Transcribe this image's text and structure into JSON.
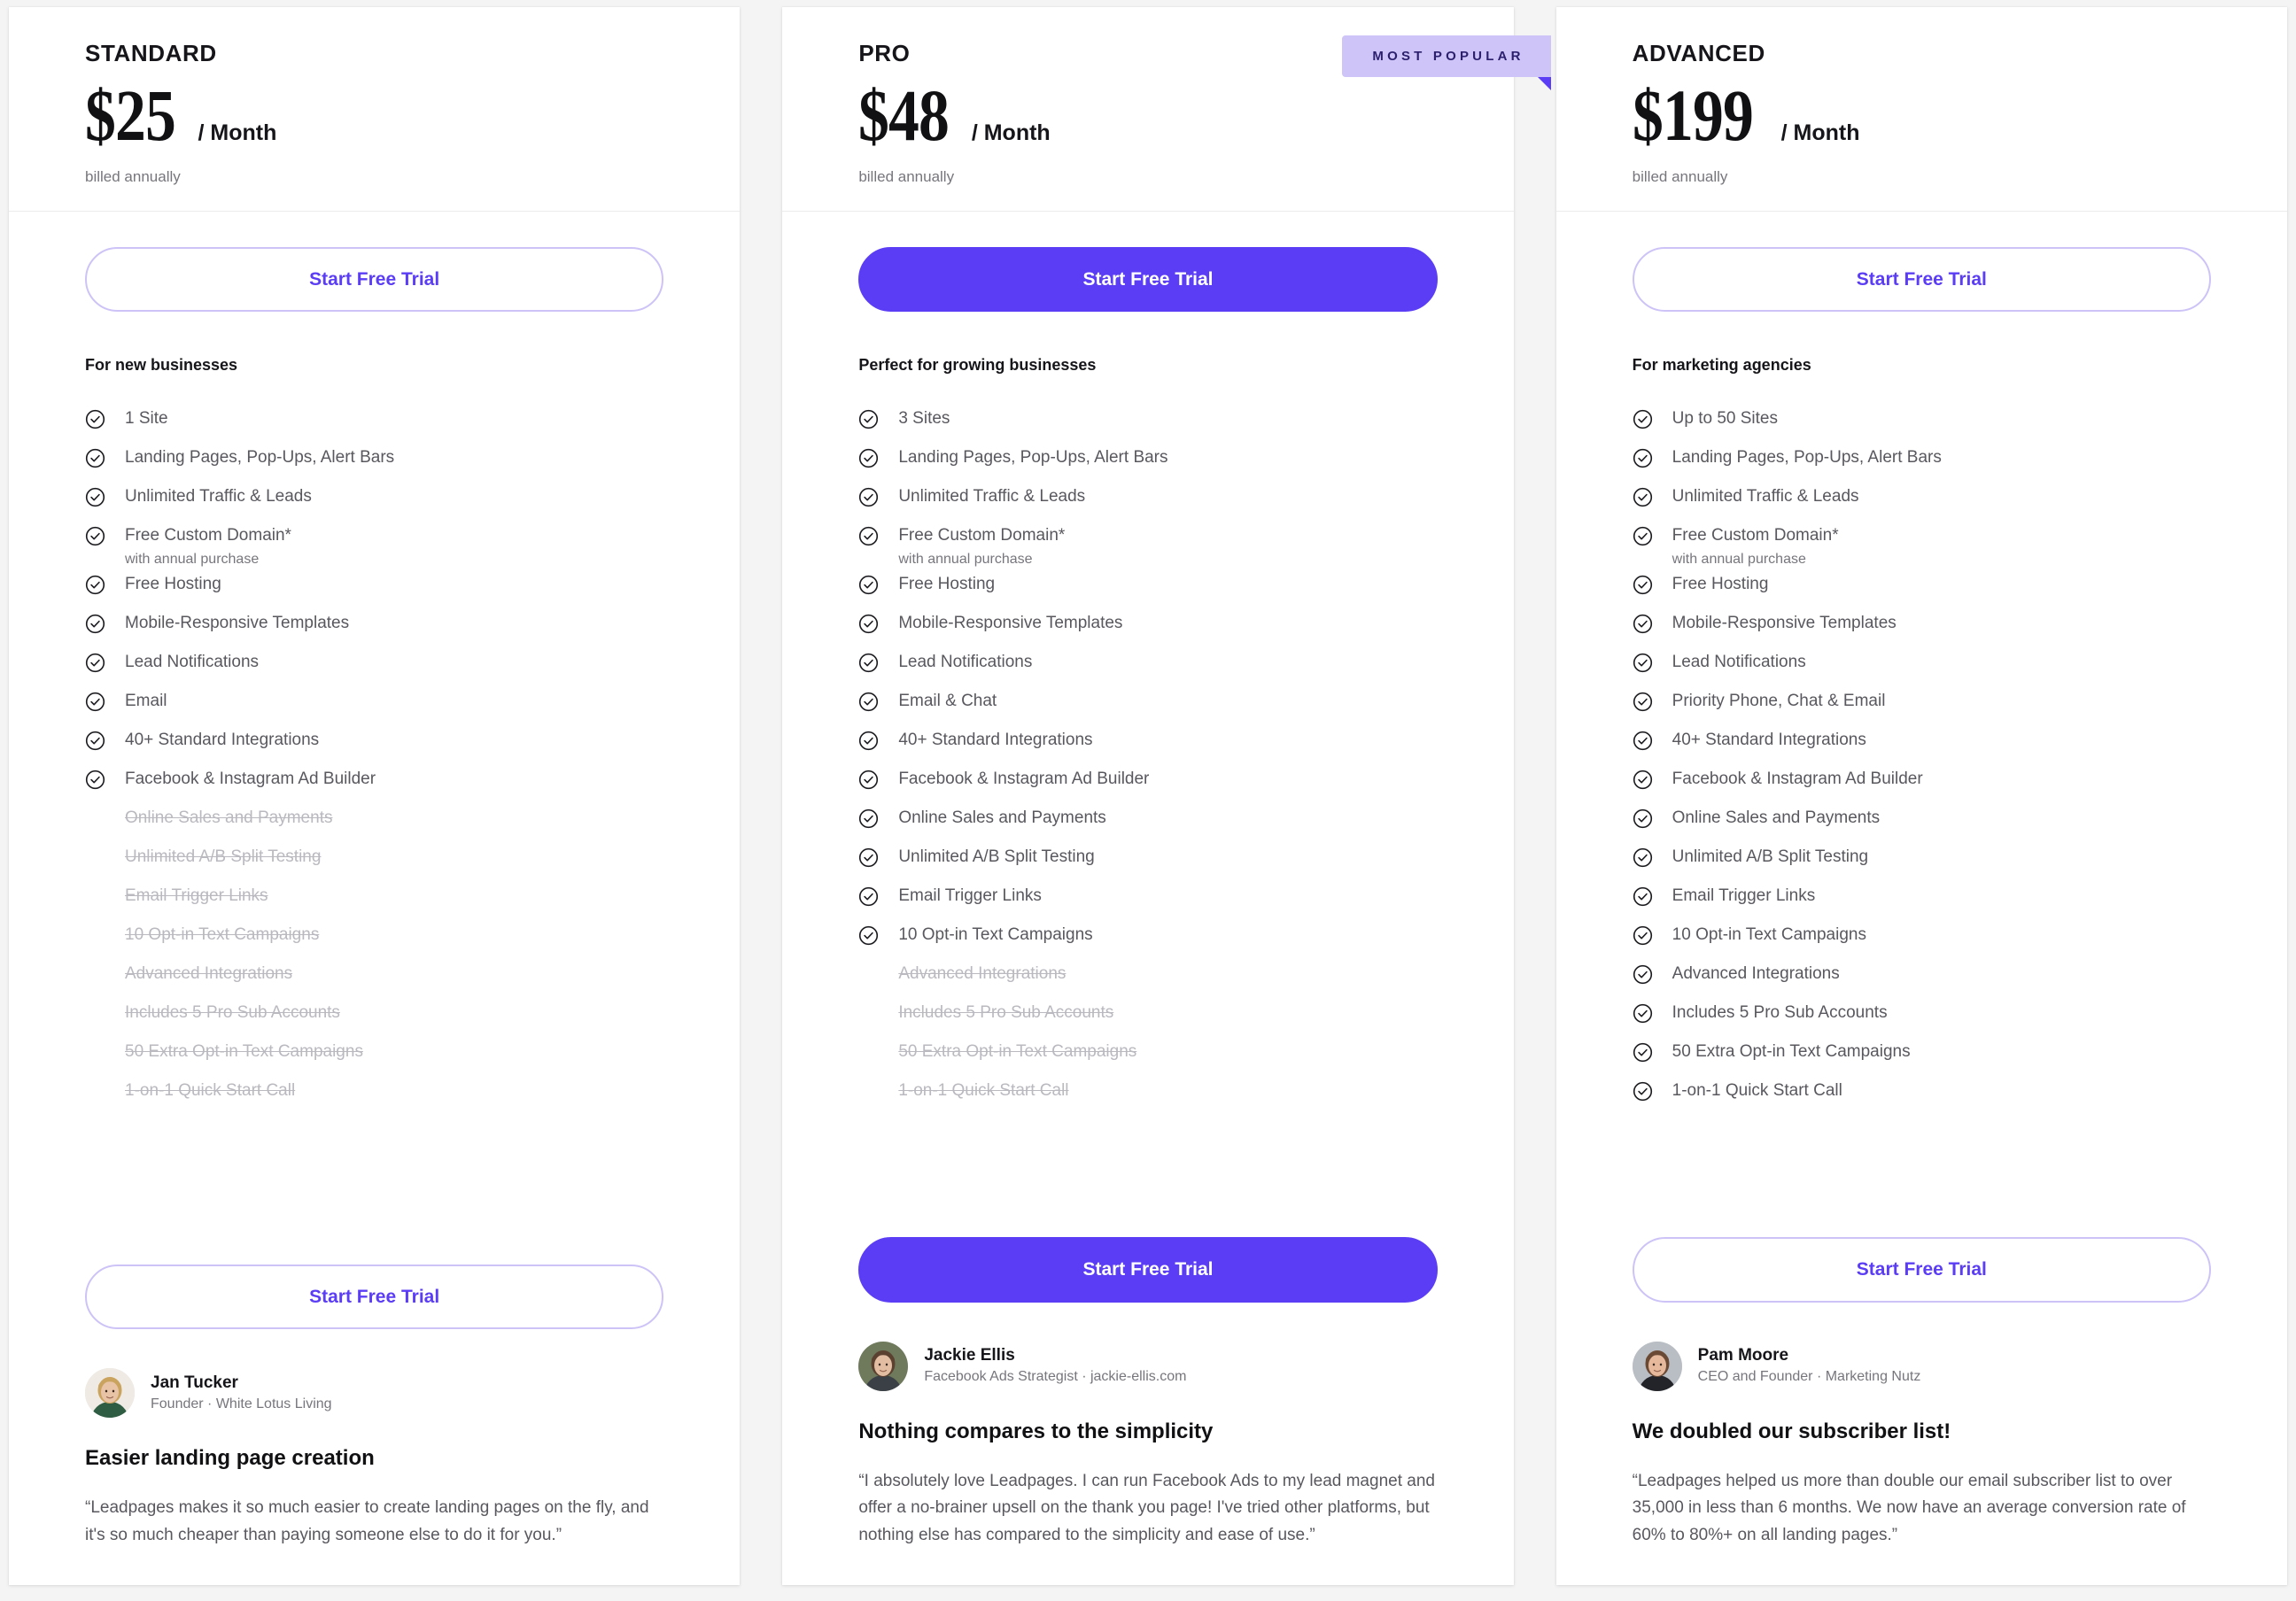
{
  "colors": {
    "accent": "#5b3df5",
    "accent_light": "#cdc3f7",
    "badge_bg": "#cec4f7",
    "badge_text": "#2b1f6e",
    "page_bg": "#f4f4f5",
    "card_bg": "#ffffff",
    "text_dark": "#16161a",
    "text_body": "#58585e",
    "text_muted": "#76767c",
    "text_disabled": "#b9b9bf"
  },
  "plans": [
    {
      "name": "STANDARD",
      "price": "$25",
      "period": "/ Month",
      "billing_note": "billed annually",
      "badge": null,
      "cta_top_label": "Start Free Trial",
      "cta_bottom_label": "Start Free Trial",
      "cta_style": "outline",
      "tagline": "For new businesses",
      "features": [
        {
          "label": "1 Site",
          "sub": null,
          "enabled": true
        },
        {
          "label": "Landing Pages, Pop-Ups, Alert Bars",
          "sub": null,
          "enabled": true
        },
        {
          "label": "Unlimited Traffic & Leads",
          "sub": null,
          "enabled": true
        },
        {
          "label": "Free Custom Domain*",
          "sub": "with annual purchase",
          "enabled": true
        },
        {
          "label": "Free Hosting",
          "sub": null,
          "enabled": true
        },
        {
          "label": "Mobile-Responsive Templates",
          "sub": null,
          "enabled": true
        },
        {
          "label": "Lead Notifications",
          "sub": null,
          "enabled": true
        },
        {
          "label": "Email",
          "sub": null,
          "enabled": true
        },
        {
          "label": "40+ Standard Integrations",
          "sub": null,
          "enabled": true
        },
        {
          "label": "Facebook & Instagram Ad Builder",
          "sub": null,
          "enabled": true
        },
        {
          "label": "Online Sales and Payments",
          "sub": null,
          "enabled": false
        },
        {
          "label": "Unlimited A/B Split Testing",
          "sub": null,
          "enabled": false
        },
        {
          "label": "Email Trigger Links",
          "sub": null,
          "enabled": false
        },
        {
          "label": "10 Opt-in Text Campaigns",
          "sub": null,
          "enabled": false
        },
        {
          "label": "Advanced Integrations",
          "sub": null,
          "enabled": false
        },
        {
          "label": "Includes 5 Pro Sub Accounts",
          "sub": null,
          "enabled": false
        },
        {
          "label": "50 Extra Opt-in Text Campaigns",
          "sub": null,
          "enabled": false
        },
        {
          "label": "1-on-1 Quick Start Call",
          "sub": null,
          "enabled": false
        }
      ],
      "testimonial": {
        "name": "Jan Tucker",
        "title": "Founder · White Lotus Living",
        "headline": "Easier landing page creation",
        "quote": "“Leadpages makes it so much easier to create landing pages on the fly, and it's so much cheaper than paying someone else to do it for you.”"
      }
    },
    {
      "name": "PRO",
      "price": "$48",
      "period": "/ Month",
      "billing_note": "billed annually",
      "badge": "MOST POPULAR",
      "cta_top_label": "Start Free Trial",
      "cta_bottom_label": "Start Free Trial",
      "cta_style": "filled",
      "tagline": "Perfect for growing businesses",
      "features": [
        {
          "label": "3 Sites",
          "sub": null,
          "enabled": true
        },
        {
          "label": "Landing Pages, Pop-Ups, Alert Bars",
          "sub": null,
          "enabled": true
        },
        {
          "label": "Unlimited Traffic & Leads",
          "sub": null,
          "enabled": true
        },
        {
          "label": "Free Custom Domain*",
          "sub": "with annual purchase",
          "enabled": true
        },
        {
          "label": "Free Hosting",
          "sub": null,
          "enabled": true
        },
        {
          "label": "Mobile-Responsive Templates",
          "sub": null,
          "enabled": true
        },
        {
          "label": "Lead Notifications",
          "sub": null,
          "enabled": true
        },
        {
          "label": "Email & Chat",
          "sub": null,
          "enabled": true
        },
        {
          "label": "40+ Standard Integrations",
          "sub": null,
          "enabled": true
        },
        {
          "label": "Facebook & Instagram Ad Builder",
          "sub": null,
          "enabled": true
        },
        {
          "label": "Online Sales and Payments",
          "sub": null,
          "enabled": true
        },
        {
          "label": "Unlimited A/B Split Testing",
          "sub": null,
          "enabled": true
        },
        {
          "label": "Email Trigger Links",
          "sub": null,
          "enabled": true
        },
        {
          "label": "10 Opt-in Text Campaigns",
          "sub": null,
          "enabled": true
        },
        {
          "label": "Advanced Integrations",
          "sub": null,
          "enabled": false
        },
        {
          "label": "Includes 5 Pro Sub Accounts",
          "sub": null,
          "enabled": false
        },
        {
          "label": "50 Extra Opt-in Text Campaigns",
          "sub": null,
          "enabled": false
        },
        {
          "label": "1-on-1 Quick Start Call",
          "sub": null,
          "enabled": false
        }
      ],
      "testimonial": {
        "name": "Jackie Ellis",
        "title": "Facebook Ads Strategist · jackie-ellis.com",
        "headline": "Nothing compares to the simplicity",
        "quote": "“I absolutely love Leadpages. I can run Facebook Ads to my lead magnet and offer a no-brainer upsell on the thank you page! I've tried other platforms, but nothing else has compared to the simplicity and ease of use.”"
      }
    },
    {
      "name": "ADVANCED",
      "price": "$199",
      "period": "/ Month",
      "billing_note": "billed annually",
      "badge": null,
      "cta_top_label": "Start Free Trial",
      "cta_bottom_label": "Start Free Trial",
      "cta_style": "outline",
      "tagline": "For marketing agencies",
      "features": [
        {
          "label": "Up to 50 Sites",
          "sub": null,
          "enabled": true
        },
        {
          "label": "Landing Pages, Pop-Ups, Alert Bars",
          "sub": null,
          "enabled": true
        },
        {
          "label": "Unlimited Traffic & Leads",
          "sub": null,
          "enabled": true
        },
        {
          "label": "Free Custom Domain*",
          "sub": "with annual purchase",
          "enabled": true
        },
        {
          "label": "Free Hosting",
          "sub": null,
          "enabled": true
        },
        {
          "label": "Mobile-Responsive Templates",
          "sub": null,
          "enabled": true
        },
        {
          "label": "Lead Notifications",
          "sub": null,
          "enabled": true
        },
        {
          "label": "Priority Phone, Chat & Email",
          "sub": null,
          "enabled": true
        },
        {
          "label": "40+ Standard Integrations",
          "sub": null,
          "enabled": true
        },
        {
          "label": "Facebook & Instagram Ad Builder",
          "sub": null,
          "enabled": true
        },
        {
          "label": "Online Sales and Payments",
          "sub": null,
          "enabled": true
        },
        {
          "label": "Unlimited A/B Split Testing",
          "sub": null,
          "enabled": true
        },
        {
          "label": "Email Trigger Links",
          "sub": null,
          "enabled": true
        },
        {
          "label": "10 Opt-in Text Campaigns",
          "sub": null,
          "enabled": true
        },
        {
          "label": "Advanced Integrations",
          "sub": null,
          "enabled": true
        },
        {
          "label": "Includes 5 Pro Sub Accounts",
          "sub": null,
          "enabled": true
        },
        {
          "label": "50 Extra Opt-in Text Campaigns",
          "sub": null,
          "enabled": true
        },
        {
          "label": "1-on-1 Quick Start Call",
          "sub": null,
          "enabled": true
        }
      ],
      "testimonial": {
        "name": "Pam Moore",
        "title": "CEO and Founder · Marketing Nutz",
        "headline": "We doubled our subscriber list!",
        "quote": "“Leadpages helped us more than double our email subscriber list to over 35,000 in less than 6 months. We now have an average conversion rate of 60% to 80%+ on all landing pages.”"
      }
    }
  ]
}
